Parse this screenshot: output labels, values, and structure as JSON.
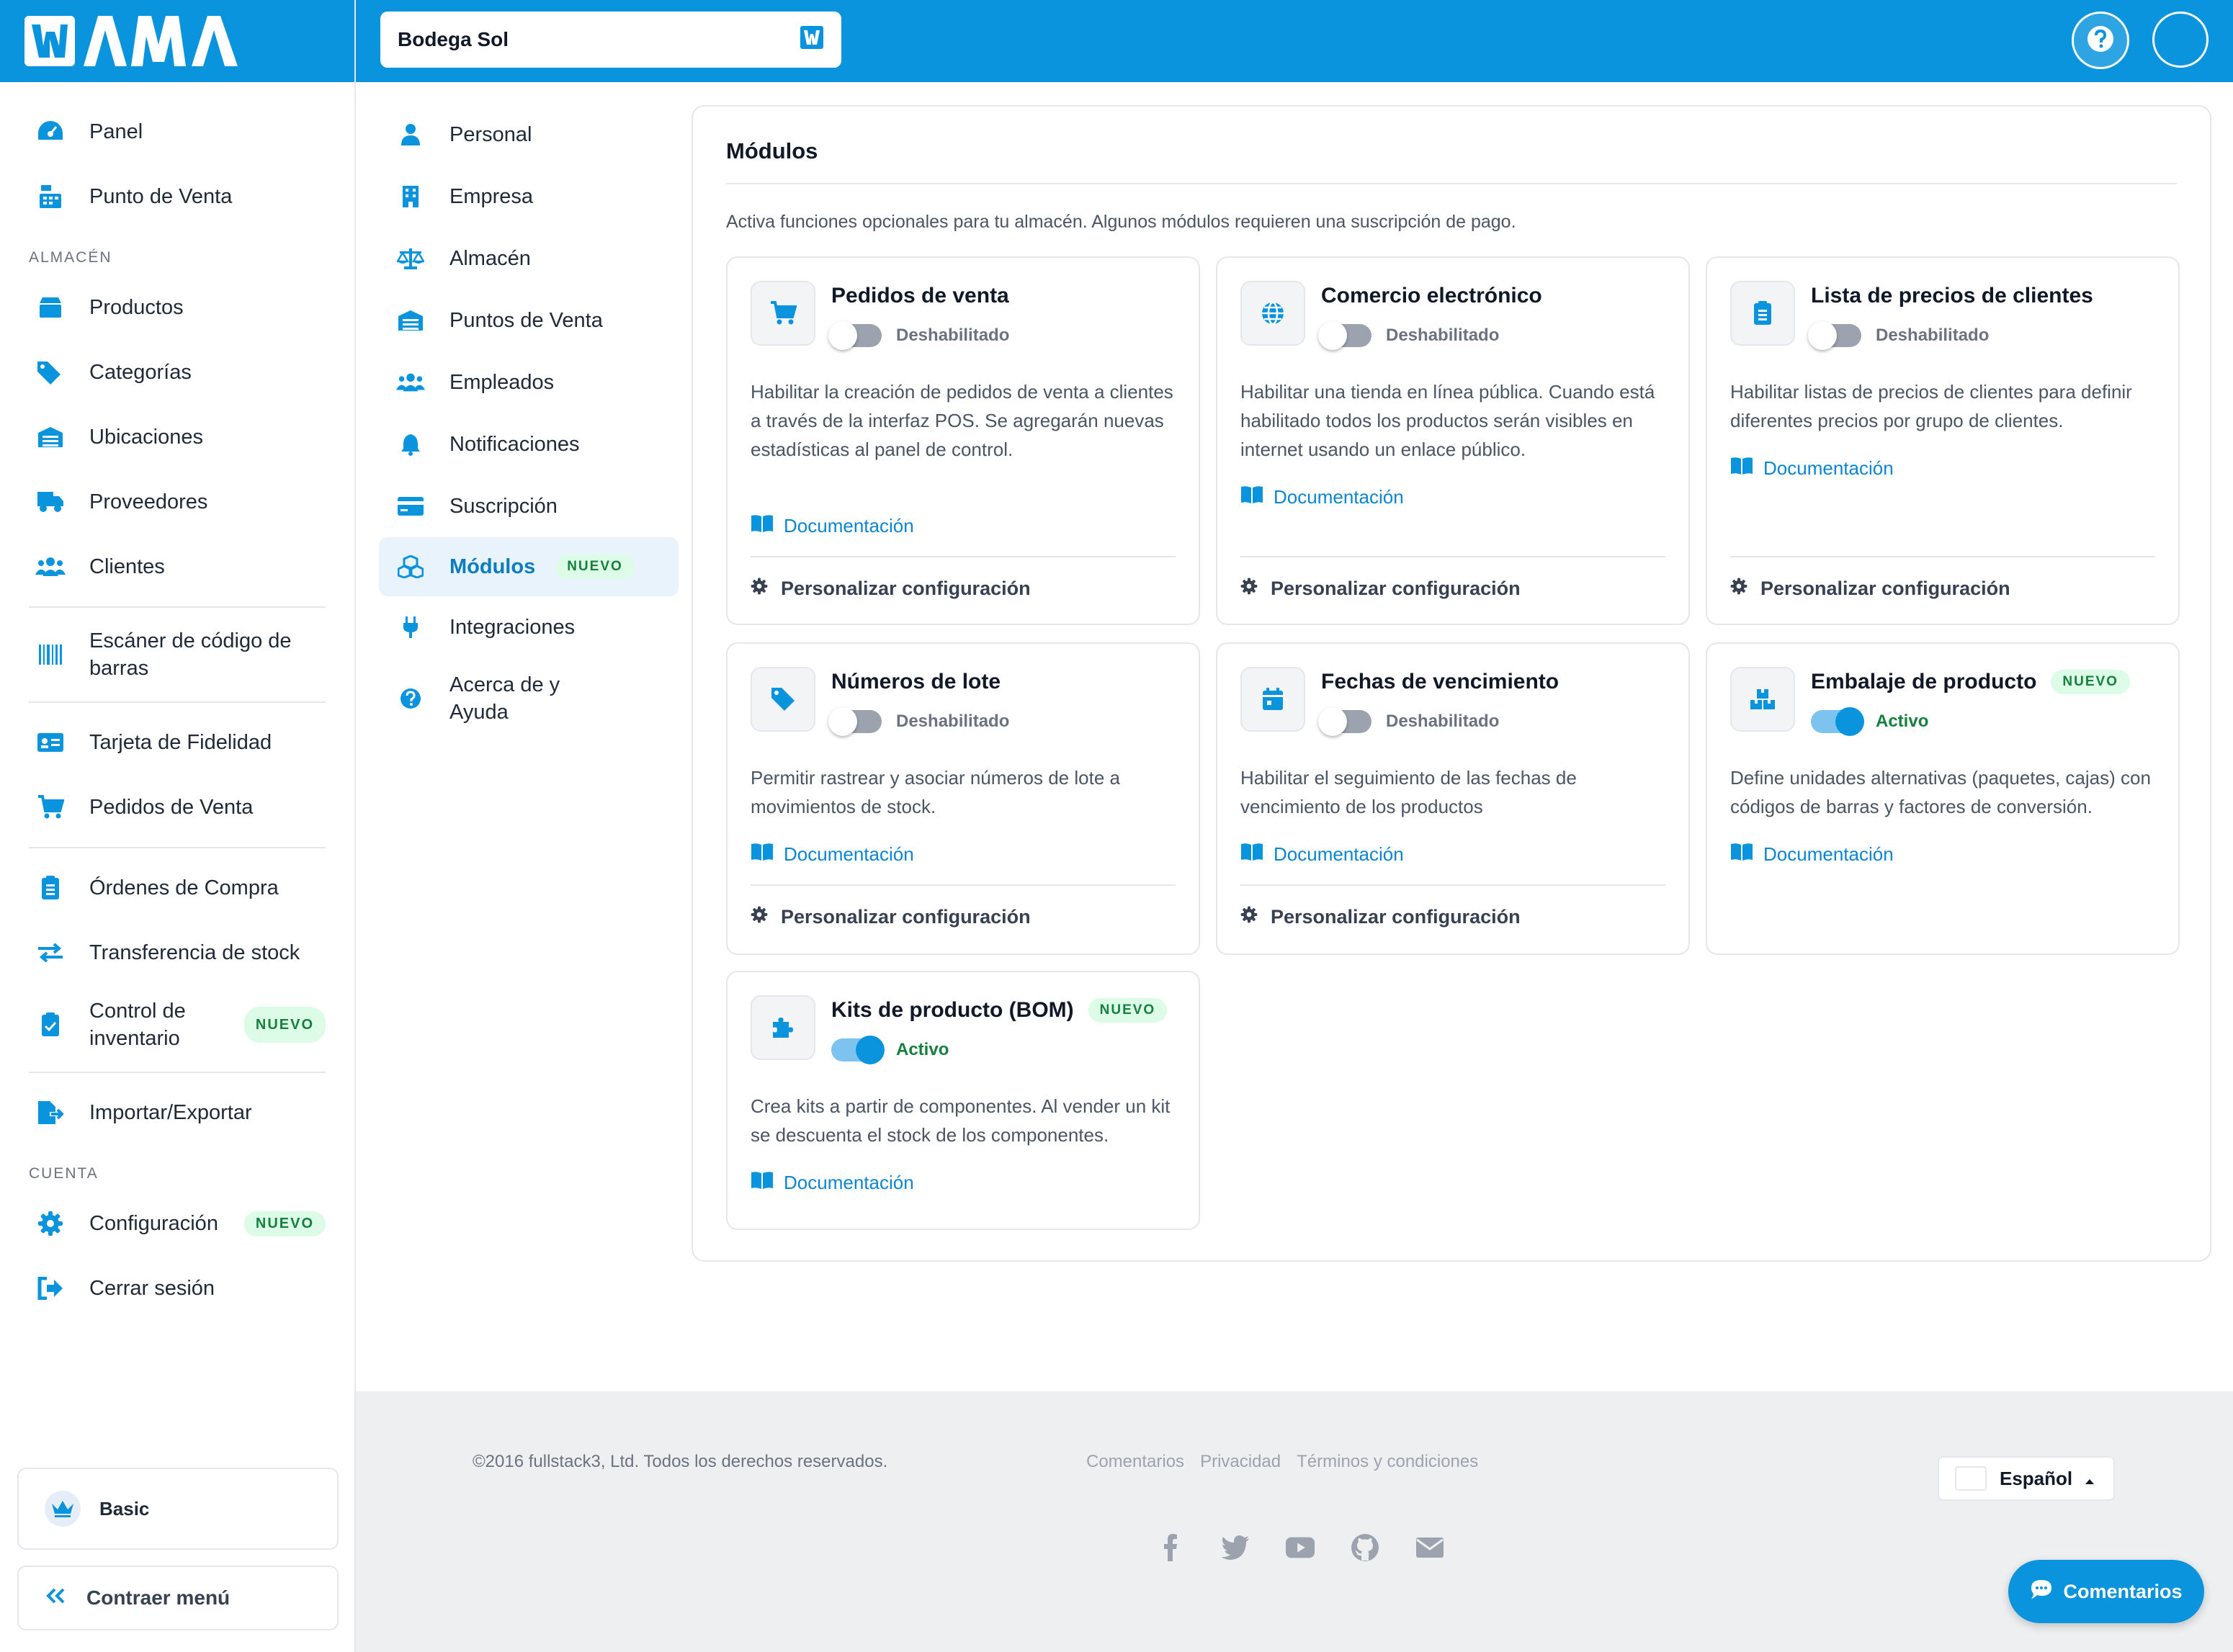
{
  "brand": {
    "logo_text": "WAMA",
    "color": "#0a94dd"
  },
  "topbar": {
    "store_name": "Bodega Sol",
    "help_icon": "question-circle-icon",
    "avatar_icon": "user-avatar-icon"
  },
  "sidebar": {
    "items_top": [
      {
        "label": "Panel",
        "icon": "dashboard-gauge-icon"
      },
      {
        "label": "Punto de Venta",
        "icon": "cash-register-icon"
      }
    ],
    "section_almacen": "ALMACÉN",
    "items_almacen": [
      {
        "label": "Productos",
        "icon": "box-icon"
      },
      {
        "label": "Categorías",
        "icon": "tags-icon"
      },
      {
        "label": "Ubicaciones",
        "icon": "warehouse-icon"
      },
      {
        "label": "Proveedores",
        "icon": "truck-icon"
      },
      {
        "label": "Clientes",
        "icon": "users-icon"
      }
    ],
    "barcode": {
      "label": "Escáner de código de barras",
      "icon": "barcode-icon"
    },
    "items_loyalty": [
      {
        "label": "Tarjeta de Fidelidad",
        "icon": "id-card-icon"
      },
      {
        "label": "Pedidos de Venta",
        "icon": "cart-icon"
      }
    ],
    "items_stock": [
      {
        "label": "Órdenes de Compra",
        "icon": "clipboard-list-icon"
      },
      {
        "label": "Transferencia de stock",
        "icon": "exchange-icon"
      },
      {
        "label": "Control de inventario",
        "icon": "clipboard-check-icon",
        "badge": "NUEVO"
      }
    ],
    "import_export": {
      "label": "Importar/Exportar",
      "icon": "file-export-icon"
    },
    "section_cuenta": "CUENTA",
    "items_cuenta": [
      {
        "label": "Configuración",
        "icon": "gear-icon",
        "badge": "NUEVO"
      },
      {
        "label": "Cerrar sesión",
        "icon": "sign-out-icon"
      }
    ],
    "plan": "Basic",
    "collapse": "Contraer menú"
  },
  "settings_nav": {
    "items": [
      {
        "label": "Personal",
        "icon": "user-icon"
      },
      {
        "label": "Empresa",
        "icon": "building-icon"
      },
      {
        "label": "Almacén",
        "icon": "balance-scale-icon"
      },
      {
        "label": "Puntos de Venta",
        "icon": "warehouse-icon"
      },
      {
        "label": "Empleados",
        "icon": "users-icon"
      },
      {
        "label": "Notificaciones",
        "icon": "bell-icon"
      },
      {
        "label": "Suscripción",
        "icon": "credit-card-icon"
      },
      {
        "label": "Módulos",
        "icon": "cubes-icon",
        "badge": "NUEVO",
        "active": true
      },
      {
        "label": "Integraciones",
        "icon": "plug-icon"
      },
      {
        "label": "Acerca de y Ayuda",
        "icon": "question-circle-icon"
      }
    ]
  },
  "modules": {
    "title": "Módulos",
    "description": "Activa funciones opcionales para tu almacén. Algunos módulos requieren una suscripción de pago.",
    "doc_label": "Documentación",
    "config_label": "Personalizar configuración",
    "status_on": "Activo",
    "status_off": "Deshabilitado",
    "badge_new": "NUEVO",
    "cards": [
      {
        "title": "Pedidos de venta",
        "icon": "cart-icon",
        "status": "Deshabilitado",
        "enabled": false,
        "description": "Habilitar la creación de pedidos de venta a clientes a través de la interfaz POS. Se agregarán nuevas estadísticas al panel de control."
      },
      {
        "title": "Comercio electrónico",
        "icon": "globe-icon",
        "status": "Deshabilitado",
        "enabled": false,
        "description": "Habilitar una tienda en línea pública. Cuando está habilitado todos los productos serán visibles en internet usando un enlace público."
      },
      {
        "title": "Lista de precios de clientes",
        "icon": "clipboard-list-icon",
        "status": "Deshabilitado",
        "enabled": false,
        "description": "Habilitar listas de precios de clientes para definir diferentes precios por grupo de clientes."
      },
      {
        "title": "Números de lote",
        "icon": "tag-icon",
        "status": "Deshabilitado",
        "enabled": false,
        "description": "Permitir rastrear y asociar números de lote a movimientos de stock."
      },
      {
        "title": "Fechas de vencimiento",
        "icon": "calendar-icon",
        "status": "Deshabilitado",
        "enabled": false,
        "description": "Habilitar el seguimiento de las fechas de vencimiento de los productos"
      },
      {
        "title": "Embalaje de producto",
        "icon": "boxes-icon",
        "status": "Activo",
        "enabled": true,
        "badge": "NUEVO",
        "description": "Define unidades alternativas (paquetes, cajas) con códigos de barras y factores de conversión."
      },
      {
        "title": "Kits de producto (BOM)",
        "icon": "puzzle-icon",
        "status": "Activo",
        "enabled": true,
        "badge": "NUEVO",
        "description": "Crea kits a partir de componentes. Al vender un kit se descuenta el stock de los componentes."
      }
    ]
  },
  "footer": {
    "copyright": "©2016 fullstack3, Ltd. Todos los derechos reservados.",
    "links": [
      "Comentarios",
      "Privacidad",
      "Términos y condiciones"
    ],
    "language": "Español",
    "socials": [
      "facebook-icon",
      "twitter-icon",
      "youtube-icon",
      "github-icon",
      "envelope-icon"
    ]
  },
  "chat_button": "Comentarios"
}
